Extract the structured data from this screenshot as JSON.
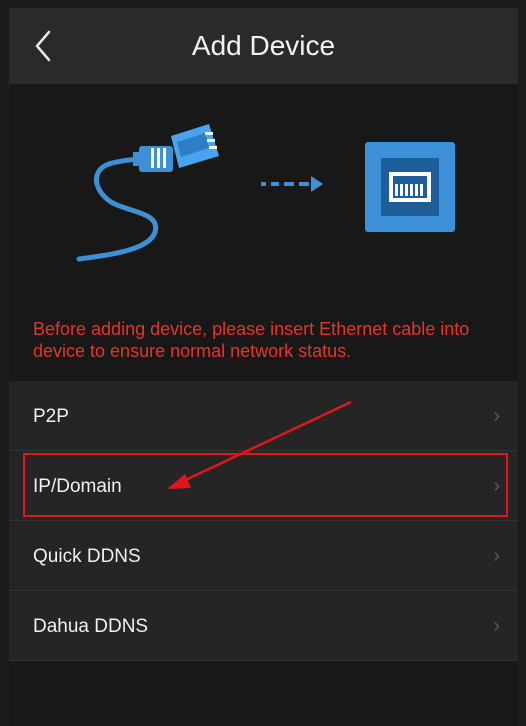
{
  "header": {
    "back_icon": "chevron-left-icon",
    "title": "Add Device"
  },
  "illustration": {
    "cable_icon": "ethernet-cable-icon",
    "arrow_icon": "dashed-arrow-right-icon",
    "port_icon": "ethernet-port-icon",
    "accent_color": "#3d8fd6"
  },
  "notice": {
    "text": "Before adding device, please insert Ethernet cable into device to ensure normal network status.",
    "color": "#e8332a"
  },
  "options": [
    {
      "label": "P2P",
      "chevron": "›"
    },
    {
      "label": "IP/Domain",
      "chevron": "›"
    },
    {
      "label": "Quick DDNS",
      "chevron": "›"
    },
    {
      "label": "Dahua DDNS",
      "chevron": "›"
    }
  ],
  "annotation": {
    "highlight_color": "#e0161c",
    "highlighted_option": "IP/Domain"
  }
}
